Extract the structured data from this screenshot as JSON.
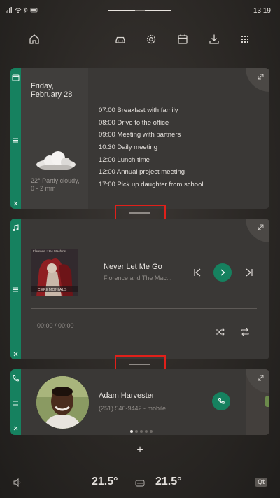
{
  "status_bar": {
    "time": "13:19"
  },
  "nav": {
    "icons": [
      "home-icon",
      "car-icon",
      "gear-icon",
      "calendar-icon",
      "download-icon",
      "apps-grid-icon"
    ]
  },
  "calendar_card": {
    "date_line1": "Friday,",
    "date_line2": "February 28",
    "weather_line1": "22° Partly cloudy,",
    "weather_line2": "0 - 2 mm",
    "events": [
      {
        "time": "07:00",
        "title": "Breakfast with family"
      },
      {
        "time": "08:00",
        "title": "Drive to the office"
      },
      {
        "time": "09:00",
        "title": "Meeting with partners"
      },
      {
        "time": "10:30",
        "title": "Daily meeting"
      },
      {
        "time": "12:00",
        "title": "Lunch time"
      },
      {
        "time": "12:00",
        "title": "Annual project meeting"
      },
      {
        "time": "17:00",
        "title": "Pick up daughter from school"
      }
    ]
  },
  "music_card": {
    "album_title": "Florence + the Machine",
    "album_caption": "CEREMONIALS",
    "track_title": "Never Let Me Go",
    "artist": "Florence and The Mac...",
    "time_display": "00:00 / 00:00",
    "progress": 0
  },
  "phone_card": {
    "contact_name": "Adam Harvester",
    "contact_number": "(251) 546-9442 - mobile",
    "page_count": 5,
    "page_index": 0
  },
  "add_label": "+",
  "footer": {
    "temp_left": "21.5°",
    "temp_right": "21.5°",
    "badge": "Qt"
  },
  "colors": {
    "accent": "#16815f",
    "card": "#3a3836",
    "highlight_box": "#e0201a"
  }
}
